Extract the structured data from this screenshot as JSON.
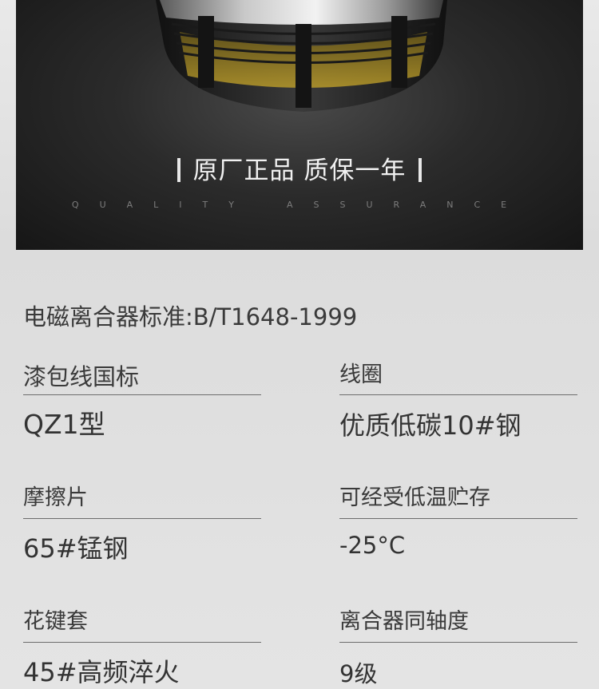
{
  "banner": {
    "title": "原厂正品 质保一年",
    "subtitle_left": "QUALITY",
    "subtitle_right": "ASSURANCE"
  },
  "standard_text": "电磁离合器标准:B/T1648-1999",
  "specs": [
    {
      "label": "漆包线国标",
      "value": "QZ1型"
    },
    {
      "label": "线圈",
      "value": "优质低碳10#钢"
    },
    {
      "label": "摩擦片",
      "value": "65#锰钢"
    },
    {
      "label": "可经受低温贮存",
      "value": "-25°C"
    },
    {
      "label": "花键套",
      "value": "45#高频淬火"
    },
    {
      "label": "离合器同轴度",
      "value": "9级"
    }
  ]
}
